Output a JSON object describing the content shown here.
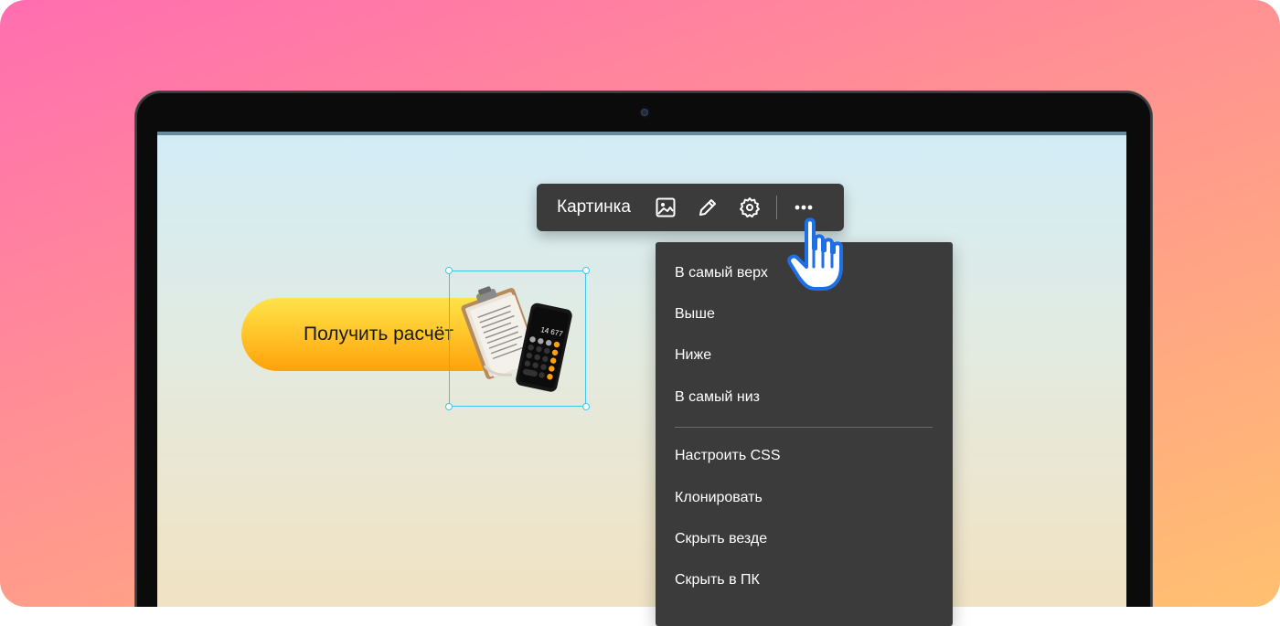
{
  "toolbar": {
    "label": "Картинка",
    "buttons": [
      {
        "icon": "image-icon"
      },
      {
        "icon": "pencil-icon"
      },
      {
        "icon": "gear-icon"
      },
      {
        "icon": "more-dots-icon"
      }
    ]
  },
  "context_menu": {
    "group1": [
      "В самый верх",
      "Выше",
      "Ниже",
      "В самый низ"
    ],
    "group2": [
      "Настроить CSS",
      "Клонировать",
      "Скрыть везде",
      "Скрыть в ПК"
    ]
  },
  "canvas": {
    "button_label": "Получить расчёт",
    "calculator_display": "14 677"
  },
  "colors": {
    "toolbar_bg": "#3b3b3b",
    "selection": "#3fc6ef",
    "button_top": "#ffe24a",
    "button_bottom": "#ffa10a"
  }
}
